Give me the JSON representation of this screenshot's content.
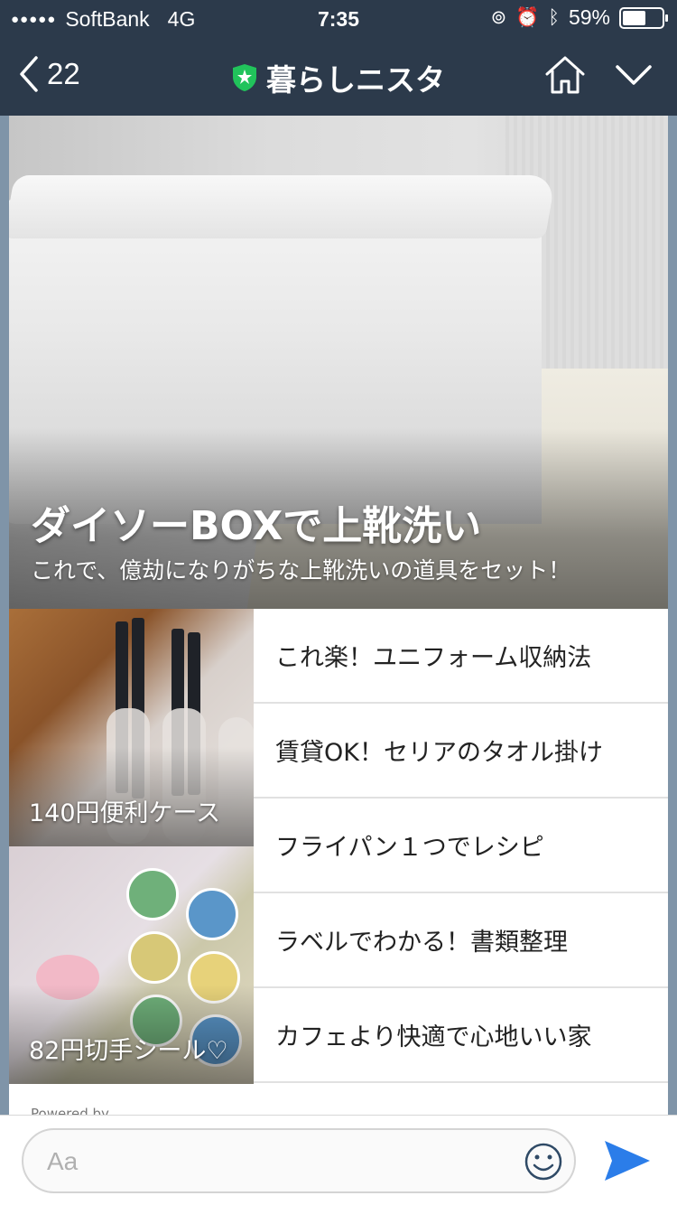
{
  "status_bar": {
    "carrier": "SoftBank",
    "network": "4G",
    "time": "7:35",
    "battery": "59%",
    "battery_level": 0.59
  },
  "nav": {
    "back_count": "22",
    "title": "暮らしニスタ"
  },
  "article": {
    "headline": "ダイソーBOXで上靴洗い",
    "subtitle": "これで、億劫になりがちな上靴洗いの道具をセット！"
  },
  "tiles": [
    {
      "caption": "140円便利ケース"
    },
    {
      "caption": "82円切手シール♡"
    }
  ],
  "links": [
    {
      "label": "これ楽！ユニフォーム収納法"
    },
    {
      "label": "賃貸OK！セリアのタオル掛け"
    },
    {
      "label": "フライパン１つでレシピ"
    },
    {
      "label": "ラベルでわかる！書類整理"
    },
    {
      "label": "カフェより快適で心地いい家"
    }
  ],
  "footer": {
    "powered": "Powered by"
  },
  "input": {
    "placeholder": "Aa"
  },
  "colors": {
    "header_bg": "#2c3a4b",
    "badge_green": "#21c35b",
    "send_blue": "#2b7de9"
  },
  "icons": [
    "back-chevron-icon",
    "official-badge-icon",
    "home-icon",
    "chevron-down-icon",
    "smiley-icon",
    "send-icon",
    "bluetooth-icon",
    "alarm-icon",
    "rotation-lock-icon"
  ]
}
